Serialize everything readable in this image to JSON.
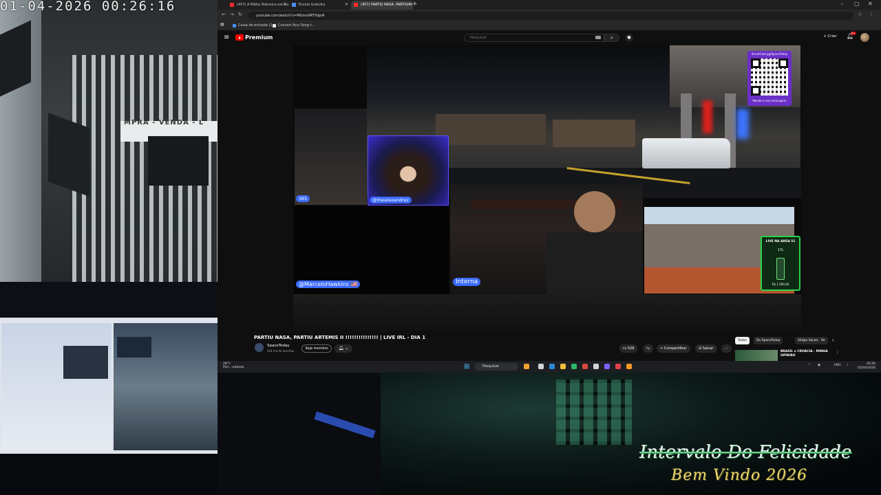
{
  "camera": {
    "timestamp": "01-04-2026  00:26:16",
    "sign_text": "MPRA - VENDA - L"
  },
  "browser": {
    "tabs": [
      {
        "title": "(457) A Bíblia Hebraica em Áu"
      },
      {
        "title": "Escola Gratuita"
      },
      {
        "title": "(457) PARTIU NASA, PARTIU AI"
      }
    ],
    "new_tab": "+",
    "url": "youtube.com/watch?v=MGmo9RTVdpiA",
    "bookmarks": [
      "Caixa de entrada (1...",
      "Convert Any Song t..."
    ]
  },
  "youtube": {
    "brand": "Premium",
    "search_placeholder": "Pesquisar",
    "criar_label": "+ Criar",
    "notif_count": "9+",
    "overlays": {
      "qr_title": "SmartCast.gg/SpaceToday",
      "qr_caption": "Mande a sua mensagem",
      "cam1_label": "365",
      "cam2_label": "@thealexandrez",
      "cam3_label": "@MarceloHawkins 🇺🇸",
      "cam4_label": "Interna",
      "live_title": "LIVE NA AREA 51",
      "live_pct": "1%",
      "live_amount": "R$ 1.000,00"
    },
    "video_title": "PARTIU NASA, PARTIU ARTEMIS II !!!!!!!!!!!!!!! | LIVE IRL - DIA 1",
    "channel": "SpaceToday",
    "subscribers": "224 mil de inscritos",
    "member_label": "Seja membro",
    "likes": "526",
    "share_label": "Compartilhar",
    "save_label": "Salvar",
    "chips": [
      "Todos",
      "Do SpaceToday",
      "Sérgio Sacani",
      "Re"
    ],
    "related_title": "BRASIL x CROÁCIA - MINHA OPINIÃO"
  },
  "taskbar": {
    "weather_temp": "28°C",
    "weather_desc": "Parc. nublado",
    "search_label": "Pesquisar",
    "lang": "ENG",
    "time": "00:26",
    "date": "02/04/2026"
  },
  "overlay_text": {
    "line1": "Intervalo Do Felicidade",
    "line2": "Bem Vindo 2026"
  },
  "colors": {
    "yt_red": "#ff0000",
    "label_blue": "#3b6bff",
    "live_green": "#2bd24b",
    "qr_purple": "#6a2fc7"
  }
}
